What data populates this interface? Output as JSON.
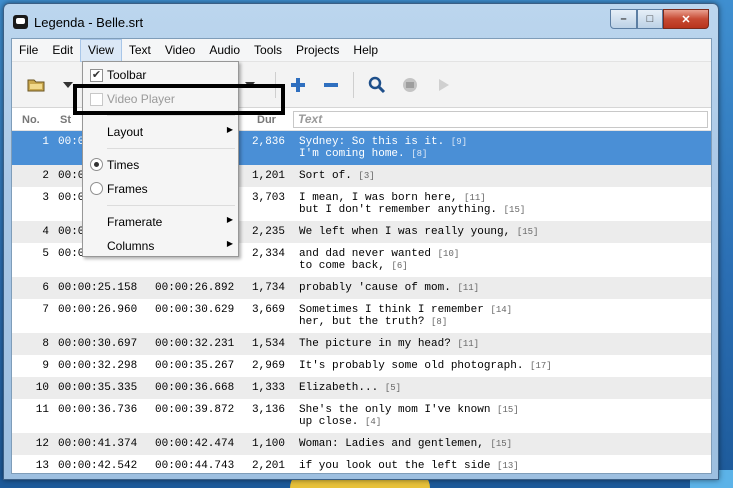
{
  "window": {
    "title": "Legenda - Belle.srt",
    "min": "–",
    "max": "□",
    "close": "✕"
  },
  "menubar": [
    "File",
    "Edit",
    "View",
    "Text",
    "Video",
    "Audio",
    "Tools",
    "Projects",
    "Help"
  ],
  "table": {
    "headers": {
      "no": "No.",
      "start": "St",
      "dur": "Dur",
      "text_filter_placeholder": "Text"
    },
    "rows": [
      {
        "no": "1",
        "start": "00:0",
        "end": "",
        "dur": "2,836",
        "line1": "Sydney: So this is it.",
        "cps1": "[9]",
        "line2": "I'm coming home.",
        "cps2": "[8]",
        "selected": true
      },
      {
        "no": "2",
        "start": "00:0",
        "end": "",
        "dur": "1,201",
        "line1": "Sort of.",
        "cps1": "[3]",
        "line2": "",
        "cps2": ""
      },
      {
        "no": "3",
        "start": "00:0",
        "end": "",
        "dur": "3,703",
        "line1": "I mean, I was born here,",
        "cps1": "[11]",
        "line2": "but I don't remember anything.",
        "cps2": "[15]"
      },
      {
        "no": "4",
        "start": "00:0",
        "end": "",
        "dur": "2,235",
        "line1": "We left when I was really young,",
        "cps1": "[15]",
        "line2": "",
        "cps2": ""
      },
      {
        "no": "5",
        "start": "00:0",
        "end": "",
        "dur": "2,334",
        "line1": "and dad never wanted",
        "cps1": "[10]",
        "line2": "to come back,",
        "cps2": "[6]"
      },
      {
        "no": "6",
        "start": "00:00:25.158",
        "end": "00:00:26.892",
        "dur": "1,734",
        "line1": "probably 'cause of mom.",
        "cps1": "[11]",
        "line2": "",
        "cps2": ""
      },
      {
        "no": "7",
        "start": "00:00:26.960",
        "end": "00:00:30.629",
        "dur": "3,669",
        "line1": "Sometimes I think I remember",
        "cps1": "[14]",
        "line2": "her, but the truth?",
        "cps2": "[8]"
      },
      {
        "no": "8",
        "start": "00:00:30.697",
        "end": "00:00:32.231",
        "dur": "1,534",
        "line1": "The picture in my head?",
        "cps1": "[11]",
        "line2": "",
        "cps2": ""
      },
      {
        "no": "9",
        "start": "00:00:32.298",
        "end": "00:00:35.267",
        "dur": "2,969",
        "line1": "It's probably some old photograph.",
        "cps1": "[17]",
        "line2": "",
        "cps2": ""
      },
      {
        "no": "10",
        "start": "00:00:35.335",
        "end": "00:00:36.668",
        "dur": "1,333",
        "line1": "Elizabeth...",
        "cps1": "[5]",
        "line2": "",
        "cps2": ""
      },
      {
        "no": "11",
        "start": "00:00:36.736",
        "end": "00:00:39.872",
        "dur": "3,136",
        "line1": "She's the only mom I've known",
        "cps1": "[15]",
        "line2": "up close.",
        "cps2": "[4]"
      },
      {
        "no": "12",
        "start": "00:00:41.374",
        "end": "00:00:42.474",
        "dur": "1,100",
        "line1": "Woman: Ladies and gentlemen,",
        "cps1": "[15]",
        "line2": "",
        "cps2": ""
      },
      {
        "no": "13",
        "start": "00:00:42.542",
        "end": "00:00:44.743",
        "dur": "2,201",
        "line1": "if you look out the left side",
        "cps1": "[13]",
        "line2": "",
        "cps2": ""
      }
    ]
  },
  "view_menu": {
    "toolbar": "Toolbar",
    "toolbar_check": "✔",
    "video_player": "Video Player",
    "layout": "Layout",
    "times": "Times",
    "frames": "Frames",
    "framerate": "Framerate",
    "columns": "Columns",
    "submenu_arrow": "▶"
  }
}
